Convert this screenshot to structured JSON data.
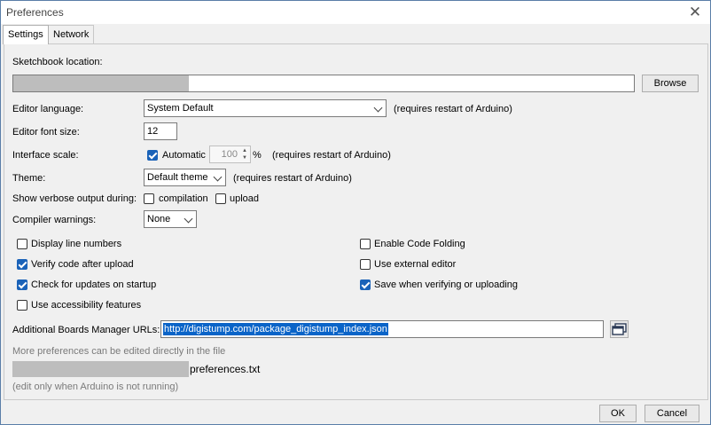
{
  "window": {
    "title": "Preferences",
    "close_icon": "close-icon"
  },
  "tabs": [
    {
      "label": "Settings",
      "active": true
    },
    {
      "label": "Network",
      "active": false
    }
  ],
  "sketchbook": {
    "label": "Sketchbook location:",
    "browse_label": "Browse"
  },
  "editor_language": {
    "label": "Editor language:",
    "value": "System Default",
    "note": "(requires restart of Arduino)"
  },
  "editor_font_size": {
    "label": "Editor font size:",
    "value": "12"
  },
  "interface_scale": {
    "label": "Interface scale:",
    "automatic_label": "Automatic",
    "automatic_checked": true,
    "value": "100",
    "unit": "%",
    "note": "(requires restart of Arduino)"
  },
  "theme": {
    "label": "Theme:",
    "value": "Default theme",
    "note": "(requires restart of Arduino)"
  },
  "verbose": {
    "label": "Show verbose output during:",
    "compilation_label": "compilation",
    "compilation_checked": false,
    "upload_label": "upload",
    "upload_checked": false
  },
  "compiler_warnings": {
    "label": "Compiler warnings:",
    "value": "None"
  },
  "options_left": [
    {
      "label": "Display line numbers",
      "checked": false
    },
    {
      "label": "Verify code after upload",
      "checked": true
    },
    {
      "label": "Check for updates on startup",
      "checked": true
    },
    {
      "label": "Use accessibility features",
      "checked": false
    }
  ],
  "options_right": [
    {
      "label": "Enable Code Folding",
      "checked": false
    },
    {
      "label": "Use external editor",
      "checked": false
    },
    {
      "label": "Save when verifying or uploading",
      "checked": true
    }
  ],
  "boards_manager": {
    "label": "Additional Boards Manager URLs:",
    "value": "http://digistump.com/package_digistump_index.json",
    "button_icon": "window-stack-icon"
  },
  "more_prefs": {
    "line1": "More preferences can be edited directly in the file",
    "file": "preferences.txt",
    "line3": "(edit only when Arduino is not running)"
  },
  "footer": {
    "ok_label": "OK",
    "cancel_label": "Cancel"
  }
}
